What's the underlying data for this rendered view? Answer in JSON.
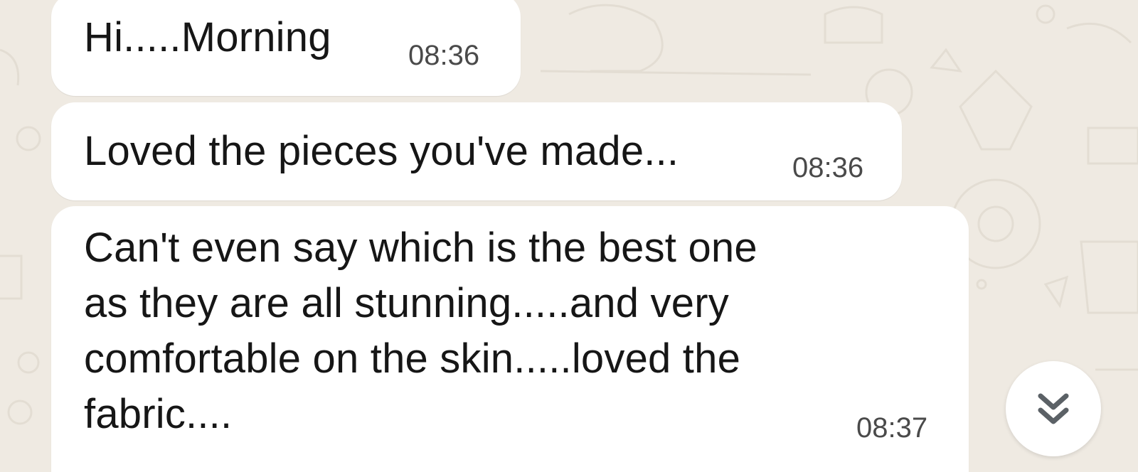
{
  "messages": [
    {
      "text": "Hi.....Morning",
      "time": "08:36"
    },
    {
      "text": "Loved the pieces you've made...",
      "time": "08:36"
    },
    {
      "text": "Can't even say which is the best one\nas they are all stunning.....and very\ncomfortable on the skin.....loved the\nfabric....",
      "time": "08:37"
    }
  ],
  "scroll_button": {
    "icon": "double-chevron-down-icon"
  },
  "colors": {
    "background": "#efeae2",
    "bubble": "#ffffff",
    "text": "#161616",
    "timestamp": "#4a4a4a"
  }
}
